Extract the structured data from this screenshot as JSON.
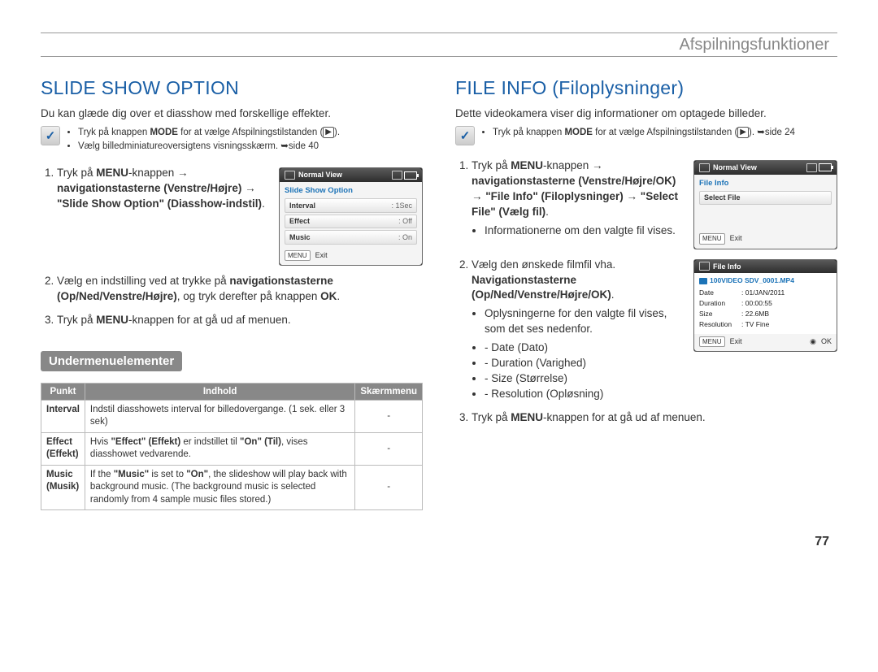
{
  "header": {
    "section_title": "Afspilningsfunktioner"
  },
  "page_number": "77",
  "left": {
    "title": "SLIDE SHOW OPTION",
    "intro": "Du kan glæde dig over et diasshow med forskellige effekter.",
    "precond": [
      "Tryk på knappen MODE for at vælge Afspilningstilstanden (▶).",
      "Vælg billedminiatureoversigtens visningsskærm. ➥side 40"
    ],
    "steps": [
      "Tryk på MENU-knappen → navigationstasterne (Venstre/Højre) → \"Slide Show Option\" (Diasshow-indstil).",
      "Vælg en indstilling ved at trykke på navigationstasterne (Op/Ned/Venstre/Højre), og tryk derefter på knappen OK.",
      "Tryk på MENU-knappen for at gå ud af menuen."
    ],
    "step1_rich": {
      "p1": "Tryk på ",
      "p2": "MENU",
      "p3": "-knappen → ",
      "p4": "navigationstasterne (Venstre/Højre) → \"Slide Show Option\" (Diasshow-indstil)",
      "p5": "."
    },
    "step2_rich": {
      "p1": "Vælg en indstilling ved at trykke på ",
      "p2": "navigationstasterne (Op/Ned/Venstre/Højre)",
      "p3": ", og tryk derefter på knappen ",
      "p4": "OK",
      "p5": "."
    },
    "step3_rich": {
      "p1": "Tryk på ",
      "p2": "MENU",
      "p3": "-knappen for at gå ud af menuen."
    },
    "lcd": {
      "view_label": "Normal View",
      "menu_title": "Slide Show Option",
      "rows": [
        {
          "label": "Interval",
          "value": ": 1Sec"
        },
        {
          "label": "Effect",
          "value": ": Off"
        },
        {
          "label": "Music",
          "value": ": On"
        }
      ],
      "foot_key": "MENU",
      "foot_label": "Exit"
    },
    "submenu_title": "Undermenuelementer",
    "submenu_headers": {
      "col1": "Punkt",
      "col2": "Indhold",
      "col3": "Skærmmenu"
    },
    "submenu_rows": [
      {
        "label": "Interval",
        "desc_plain": "Indstil diasshowets interval for billedovergange. (1 sek. eller 3 sek)",
        "screen": "-"
      },
      {
        "label": "Effect (Effekt)",
        "desc_pre": "Hvis ",
        "desc_bold1": "\"Effect\" (Effekt)",
        "desc_mid": " er indstillet til ",
        "desc_bold2": "\"On\" (Til)",
        "desc_post": ", vises diasshowet vedvarende.",
        "screen": "-"
      },
      {
        "label": "Music (Musik)",
        "desc_pre": "If the ",
        "desc_bold1": "\"Music\"",
        "desc_mid": " is set to ",
        "desc_bold2": "\"On\"",
        "desc_post": ", the slideshow will play back with background music. (The background music is selected randomly from 4 sample music files stored.)",
        "screen": "-"
      }
    ]
  },
  "right": {
    "title": "FILE INFO (Filoplysninger)",
    "intro": "Dette videokamera viser dig informationer om optagede billeder.",
    "precond": [
      "Tryk på knappen MODE for at vælge Afspilningstilstanden (▶). ➥side 24"
    ],
    "step1_rich": {
      "p1": "Tryk på ",
      "p2": "MENU",
      "p3": "-knappen → ",
      "p4": "navigationstasterne (Venstre/Højre/OK) → \"File Info\" (Filoplysninger) → \"Select File\" (Vælg fil)",
      "p5": "."
    },
    "step1_bullet": "Informationerne om den valgte fil vises.",
    "step2_rich": {
      "p1": "Vælg den ønskede filmfil vha. ",
      "p2": "Navigationstasterne (Op/Ned/Venstre/Højre/OK)",
      "p3": "."
    },
    "step2_bullet": "Oplysningerne for den valgte fil vises, som det ses nedenfor.",
    "step2_dashes": [
      "Date (Dato)",
      "Duration (Varighed)",
      "Size (Størrelse)",
      "Resolution (Opløsning)"
    ],
    "step3_rich": {
      "p1": "Tryk på ",
      "p2": "MENU",
      "p3": "-knappen for at gå ud af menuen."
    },
    "lcd1": {
      "view_label": "Normal View",
      "menu_title": "File Info",
      "row": "Select File",
      "foot_key": "MENU",
      "foot_label": "Exit"
    },
    "lcd2": {
      "title": "File Info",
      "path": "100VIDEO  SDV_0001.MP4",
      "rows": [
        {
          "k": "Date",
          "v": "01/JAN/2011"
        },
        {
          "k": "Duration",
          "v": "00:00:55"
        },
        {
          "k": "Size",
          "v": "22.6MB"
        },
        {
          "k": "Resolution",
          "v": "TV Fine"
        }
      ],
      "foot_key1": "MENU",
      "foot_label1": "Exit",
      "foot_label2": "OK"
    }
  }
}
